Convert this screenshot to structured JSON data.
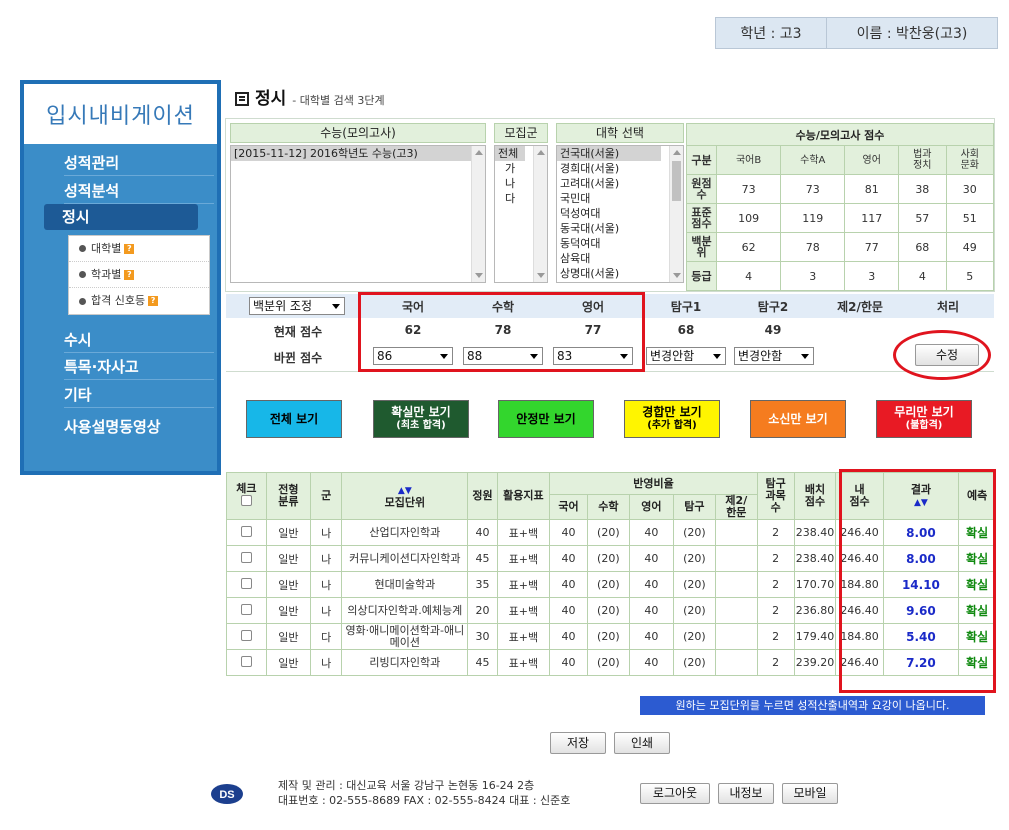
{
  "user": {
    "grade": "학년 : 고3",
    "name": "이름 : 박찬웅(고3)"
  },
  "sidebar": {
    "logo": "입시내비게이션",
    "menu": [
      "성적관리",
      "성적분석",
      "정시",
      "수시",
      "특목·자사고",
      "기타",
      "사용설명동영상"
    ],
    "submenu": [
      "대학별",
      "학과별",
      "합격 신호등"
    ],
    "help_icon": "?"
  },
  "page": {
    "title": "정시",
    "subtitle": "- 대학별 검색 3단계"
  },
  "search": {
    "exam_header": "수능(모의고사)",
    "exam_options": [
      "[2015-11-12]  2016학년도 수능(고3)"
    ],
    "group_header": "모집군",
    "group_options": [
      "전체",
      "가",
      "나",
      "다"
    ],
    "univ_header": "대학 선택",
    "univ_options": [
      "건국대(서울)",
      "경희대(서울)",
      "고려대(서울)",
      "국민대",
      "덕성여대",
      "동국대(서울)",
      "동덕여대",
      "삼육대",
      "상명대(서울)"
    ]
  },
  "scores": {
    "header": "수능/모의고사 점수",
    "columns": [
      "구분",
      "국어B",
      "수학A",
      "영어",
      "법과\n정치",
      "사회\n문화"
    ],
    "rows": [
      {
        "label": "원점\n수",
        "values": [
          "73",
          "73",
          "81",
          "38",
          "30"
        ]
      },
      {
        "label": "표준\n점수",
        "values": [
          "109",
          "119",
          "117",
          "57",
          "51"
        ]
      },
      {
        "label": "백분\n위",
        "values": [
          "62",
          "78",
          "77",
          "68",
          "49"
        ]
      },
      {
        "label": "등급",
        "values": [
          "4",
          "3",
          "3",
          "4",
          "5"
        ]
      }
    ]
  },
  "adjust": {
    "mode_select": "백분위 조정",
    "headers": [
      "국어",
      "수학",
      "영어",
      "탐구1",
      "탐구2",
      "제2/한문",
      "처리"
    ],
    "current_label": "현재 점수",
    "current": [
      "62",
      "78",
      "77",
      "68",
      "49"
    ],
    "changed_label": "바뀐 점수",
    "changed": [
      "86",
      "88",
      "83",
      "변경안함",
      "변경안함"
    ],
    "modify_button": "수정"
  },
  "filters": [
    {
      "label": "전체 보기",
      "sub": "",
      "bg": "#17b7e8",
      "fg": "#000000"
    },
    {
      "label": "확실만 보기",
      "sub": "(최초 합격)",
      "bg": "#1f5a2f",
      "fg": "#ffffff"
    },
    {
      "label": "안정만 보기",
      "sub": "",
      "bg": "#33d62d",
      "fg": "#000000"
    },
    {
      "label": "경합만 보기",
      "sub": "(추가 합격)",
      "bg": "#fff500",
      "fg": "#000000"
    },
    {
      "label": "소신만 보기",
      "sub": "",
      "bg": "#f57c1f",
      "fg": "#ffffff"
    },
    {
      "label": "무리만 보기",
      "sub": "(불합격)",
      "bg": "#e81a24",
      "fg": "#ffffff"
    }
  ],
  "results": {
    "headers": {
      "check": "체크",
      "type": "전형\n분류",
      "group": "군",
      "unit": "모집단위",
      "quota": "정원",
      "index": "활용지표",
      "ratio": "반영비율",
      "kor": "국어",
      "math": "수학",
      "eng": "영어",
      "inq": "탐구",
      "second": "제2/\n한문",
      "inq_count": "탐구\n과목\n수",
      "max": "배치\n점수",
      "mine": "내\n점수",
      "result": "결과",
      "predict": "예측"
    },
    "rows": [
      {
        "type": "일반",
        "group": "나",
        "unit": "산업디자인학과",
        "quota": "40",
        "index": "표+백",
        "kor": "40",
        "math": "(20)",
        "eng": "40",
        "inq": "(20)",
        "second": "",
        "inq_count": "2",
        "max": "238.40",
        "mine": "246.40",
        "result": "8.00",
        "predict": "확실"
      },
      {
        "type": "일반",
        "group": "나",
        "unit": "커뮤니케이션디자인학과",
        "quota": "45",
        "index": "표+백",
        "kor": "40",
        "math": "(20)",
        "eng": "40",
        "inq": "(20)",
        "second": "",
        "inq_count": "2",
        "max": "238.40",
        "mine": "246.40",
        "result": "8.00",
        "predict": "확실"
      },
      {
        "type": "일반",
        "group": "나",
        "unit": "현대미술학과",
        "quota": "35",
        "index": "표+백",
        "kor": "40",
        "math": "(20)",
        "eng": "40",
        "inq": "(20)",
        "second": "",
        "inq_count": "2",
        "max": "170.70",
        "mine": "184.80",
        "result": "14.10",
        "predict": "확실"
      },
      {
        "type": "일반",
        "group": "나",
        "unit": "의상디자인학과.예체능계",
        "quota": "20",
        "index": "표+백",
        "kor": "40",
        "math": "(20)",
        "eng": "40",
        "inq": "(20)",
        "second": "",
        "inq_count": "2",
        "max": "236.80",
        "mine": "246.40",
        "result": "9.60",
        "predict": "확실"
      },
      {
        "type": "일반",
        "group": "다",
        "unit": "영화·애니메이션학과-애니메이션",
        "quota": "30",
        "index": "표+백",
        "kor": "40",
        "math": "(20)",
        "eng": "40",
        "inq": "(20)",
        "second": "",
        "inq_count": "2",
        "max": "179.40",
        "mine": "184.80",
        "result": "5.40",
        "predict": "확실"
      },
      {
        "type": "일반",
        "group": "나",
        "unit": "리빙디자인학과",
        "quota": "45",
        "index": "표+백",
        "kor": "40",
        "math": "(20)",
        "eng": "40",
        "inq": "(20)",
        "second": "",
        "inq_count": "2",
        "max": "239.20",
        "mine": "246.40",
        "result": "7.20",
        "predict": "확실"
      }
    ]
  },
  "notice": "원하는 모집단위를 누르면 성적산출내역과 요강이 나옵니다.",
  "actions": {
    "save": "저장",
    "print": "인쇄"
  },
  "footer": {
    "logo": "DS",
    "line1": "제작 및 관리 : 대신교육 서울 강남구 논현동 16-24 2층",
    "line2": "대표번호 : 02-555-8689   FAX : 02-555-8424   대표 : 신준호",
    "logout": "로그아웃",
    "myinfo": "내정보",
    "mobile": "모바일"
  }
}
